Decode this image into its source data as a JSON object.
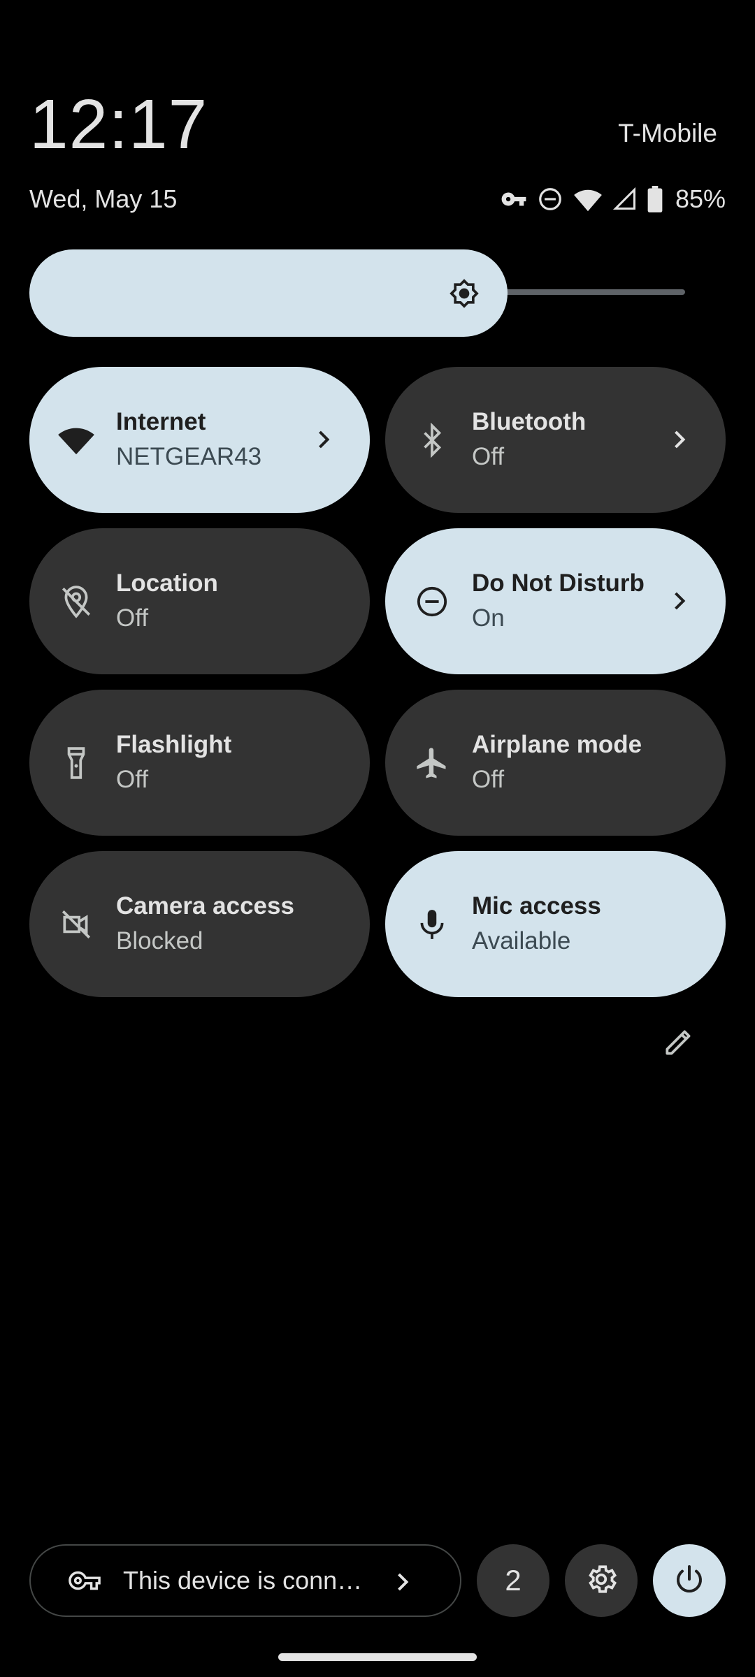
{
  "header": {
    "time": "12:17",
    "carrier": "T-Mobile",
    "date": "Wed, May 15",
    "battery_percent": "85%",
    "status_icons": [
      "vpn-key-icon",
      "do-not-disturb-icon",
      "wifi-icon",
      "cell-signal-icon",
      "battery-icon"
    ]
  },
  "brightness": {
    "level": 0.75,
    "icon": "brightness-icon"
  },
  "tiles": [
    {
      "title": "Internet",
      "subtitle": "NETGEAR43",
      "state": "on",
      "icon": "wifi-icon",
      "chevron": true
    },
    {
      "title": "Bluetooth",
      "subtitle": "Off",
      "state": "off",
      "icon": "bluetooth-icon",
      "chevron": true
    },
    {
      "title": "Location",
      "subtitle": "Off",
      "state": "off",
      "icon": "location-off-icon",
      "chevron": false
    },
    {
      "title": "Do Not Disturb",
      "subtitle": "On",
      "state": "on",
      "icon": "do-not-disturb-icon",
      "chevron": true
    },
    {
      "title": "Flashlight",
      "subtitle": "Off",
      "state": "off",
      "icon": "flashlight-icon",
      "chevron": false
    },
    {
      "title": "Airplane mode",
      "subtitle": "Off",
      "state": "off",
      "icon": "airplane-icon",
      "chevron": false
    },
    {
      "title": "Camera access",
      "subtitle": "Blocked",
      "state": "off",
      "icon": "camera-off-icon",
      "chevron": false
    },
    {
      "title": "Mic access",
      "subtitle": "Available",
      "state": "on",
      "icon": "mic-icon",
      "chevron": false
    }
  ],
  "footer": {
    "vpn_text": "This device is conn…",
    "notification_count": "2",
    "settings_icon": "gear-icon",
    "power_icon": "power-icon"
  },
  "colors": {
    "tile_on": "#d3e3ec",
    "tile_off": "#333333",
    "background": "#000000"
  }
}
